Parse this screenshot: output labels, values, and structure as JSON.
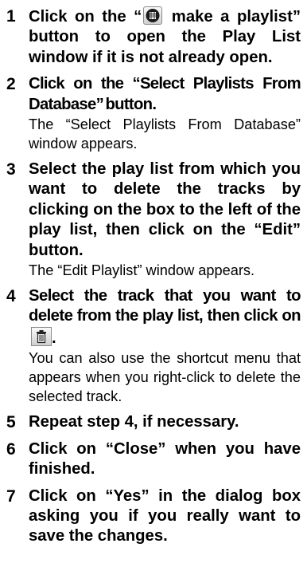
{
  "steps": [
    {
      "number": "1",
      "text_before_icon": "Click on the “",
      "icon": "playlist-record-icon",
      "text_after_icon": " make a playlist” button to open the Play List window if it is not already open."
    },
    {
      "number": "2",
      "text": "Click on the “Select Playlists From Database” button.",
      "note": "The “Select Playlists From Database” window appears."
    },
    {
      "number": "3",
      "text": "Select the play list from which you want to delete the tracks by clicking on the box to the left of the play list, then click on the “Edit” button.",
      "note": "The “Edit Playlist” window appears."
    },
    {
      "number": "4",
      "text": "Select the track that you want to delete from the play list, then click on",
      "icon": "trash-icon",
      "text_end": ".",
      "note": "You can also use the shortcut menu that appears when you right-click to delete the selected track."
    },
    {
      "number": "5",
      "text": "Repeat step 4, if necessary."
    },
    {
      "number": "6",
      "text": "Click on “Close” when you have finished."
    },
    {
      "number": "7",
      "text": "Click on “Yes” in the dialog box asking you if you really want to save the changes."
    }
  ]
}
